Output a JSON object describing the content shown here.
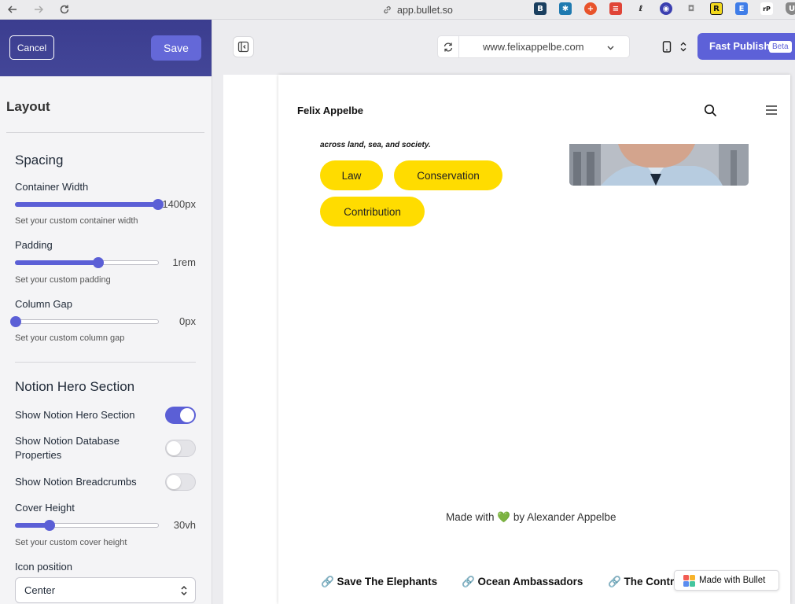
{
  "browser": {
    "address": "app.bullet.so",
    "extensions": [
      "bookmark-extension",
      "network-extension",
      "plus-extension",
      "todoist-extension",
      "signature-extension",
      "vpn-extension",
      "camera-extension",
      "r-extension",
      "e-extension",
      "rp-extension",
      "shield-extension"
    ]
  },
  "panel": {
    "cancel_label": "Cancel",
    "save_label": "Save",
    "title": "Layout",
    "spacing": {
      "heading": "Spacing",
      "container_width": {
        "label": "Container Width",
        "value": "1400px",
        "help": "Set your custom container width",
        "level": 1.0
      },
      "padding": {
        "label": "Padding",
        "value": "1rem",
        "help": "Set your custom padding",
        "level": 0.58
      },
      "column_gap": {
        "label": "Column Gap",
        "value": "0px",
        "help": "Set your custom column gap",
        "level": 0.0
      }
    },
    "hero": {
      "heading": "Notion Hero Section",
      "show_hero": {
        "label": "Show Notion Hero Section",
        "on": true
      },
      "show_db_props": {
        "label_line1": "Show Notion Database",
        "label_line2": "Properties",
        "on": false
      },
      "show_breadcrumbs": {
        "label": "Show Notion Breadcrumbs",
        "on": false
      },
      "cover_height": {
        "label": "Cover Height",
        "value": "30vh",
        "help": "Set your custom cover height",
        "level": 0.24
      },
      "icon_position": {
        "label": "Icon position",
        "selected": "Center"
      }
    }
  },
  "toolbar": {
    "url": "www.felixappelbe.com",
    "publish_label": "Fast Publish",
    "beta_badge": "Beta"
  },
  "preview": {
    "site_name": "Felix Appelbe",
    "tagline": "across land, sea, and society.",
    "tags": [
      "Law",
      "Conservation",
      "Contribution"
    ],
    "footer_text_prefix": "Made with ",
    "footer_heart": "💚",
    "footer_text_suffix": " by Alexander Appelbe",
    "links": [
      "🔗 Save The Elephants",
      "🔗 Ocean Ambassadors",
      "🔗 The Contr"
    ],
    "badge": "Made with Bullet"
  },
  "colors": {
    "accent": "#5b5fd6",
    "panel_header": "#3b3d8f",
    "tag_yellow": "#ffdc00"
  }
}
